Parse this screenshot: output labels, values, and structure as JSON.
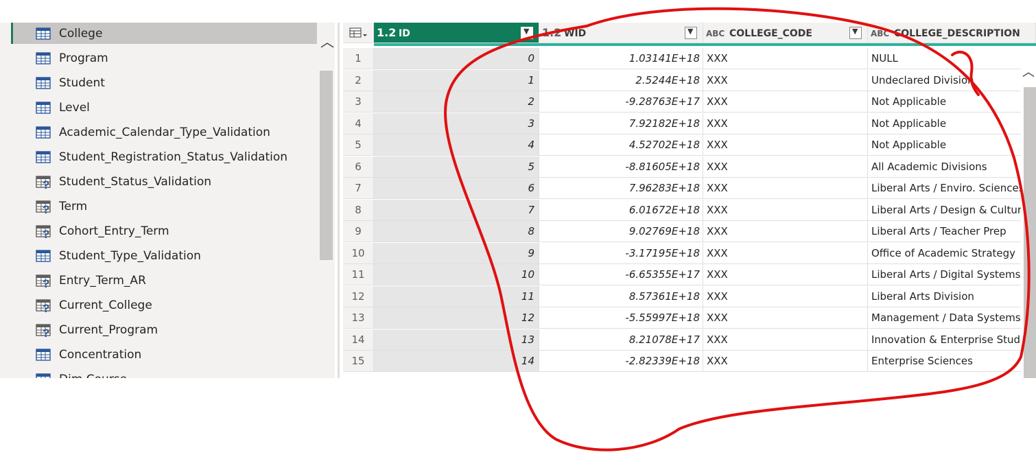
{
  "queries": {
    "items": [
      {
        "label": "College",
        "icon": "table-icon",
        "selected": true
      },
      {
        "label": "Program",
        "icon": "table-icon"
      },
      {
        "label": "Student",
        "icon": "table-icon"
      },
      {
        "label": "Level",
        "icon": "table-icon"
      },
      {
        "label": "Academic_Calendar_Type_Validation",
        "icon": "table-icon"
      },
      {
        "label": "Student_Registration_Status_Validation",
        "icon": "table-icon"
      },
      {
        "label": "Student_Status_Validation",
        "icon": "table-question-icon"
      },
      {
        "label": "Term",
        "icon": "table-question-icon"
      },
      {
        "label": "Cohort_Entry_Term",
        "icon": "table-question-icon"
      },
      {
        "label": "Student_Type_Validation",
        "icon": "table-icon"
      },
      {
        "label": "Entry_Term_AR",
        "icon": "table-question-icon"
      },
      {
        "label": "Current_College",
        "icon": "table-question-icon"
      },
      {
        "label": "Current_Program",
        "icon": "table-question-icon"
      },
      {
        "label": "Concentration",
        "icon": "table-icon"
      },
      {
        "label": "Dim Course",
        "icon": "table-icon"
      }
    ]
  },
  "grid": {
    "columns": [
      {
        "type": "1.2",
        "name": "ID"
      },
      {
        "type": "1.2",
        "name": "WID"
      },
      {
        "type": "ABC",
        "name": "COLLEGE_CODE"
      },
      {
        "type": "ABC",
        "name": "COLLEGE_DESCRIPTION"
      }
    ],
    "rows": [
      {
        "n": "1",
        "id": "0",
        "wid": "1.03141E+18",
        "code": "XXX",
        "desc": "NULL"
      },
      {
        "n": "2",
        "id": "1",
        "wid": "2.5244E+18",
        "code": "XXX",
        "desc": "Undeclared Division"
      },
      {
        "n": "3",
        "id": "2",
        "wid": "-9.28763E+17",
        "code": "XXX",
        "desc": "Not Applicable"
      },
      {
        "n": "4",
        "id": "3",
        "wid": "7.92182E+18",
        "code": "XXX",
        "desc": "Not Applicable"
      },
      {
        "n": "5",
        "id": "4",
        "wid": "4.52702E+18",
        "code": "XXX",
        "desc": "Not Applicable"
      },
      {
        "n": "6",
        "id": "5",
        "wid": "-8.81605E+18",
        "code": "XXX",
        "desc": "All Academic Divisions"
      },
      {
        "n": "7",
        "id": "6",
        "wid": "7.96283E+18",
        "code": "XXX",
        "desc": "Liberal Arts / Enviro. Sciences"
      },
      {
        "n": "8",
        "id": "7",
        "wid": "6.01672E+18",
        "code": "XXX",
        "desc": "Liberal Arts / Design & Culture"
      },
      {
        "n": "9",
        "id": "8",
        "wid": "9.02769E+18",
        "code": "XXX",
        "desc": "Liberal Arts / Teacher Prep"
      },
      {
        "n": "10",
        "id": "9",
        "wid": "-3.17195E+18",
        "code": "XXX",
        "desc": "Office of Academic Strategy"
      },
      {
        "n": "11",
        "id": "10",
        "wid": "-6.65355E+17",
        "code": "XXX",
        "desc": "Liberal Arts / Digital Systems"
      },
      {
        "n": "12",
        "id": "11",
        "wid": "8.57361E+18",
        "code": "XXX",
        "desc": "Liberal Arts Division"
      },
      {
        "n": "13",
        "id": "12",
        "wid": "-5.55997E+18",
        "code": "XXX",
        "desc": "Management / Data Systems"
      },
      {
        "n": "14",
        "id": "13",
        "wid": "8.21078E+17",
        "code": "XXX",
        "desc": "Innovation & Enterprise Studies"
      },
      {
        "n": "15",
        "id": "14",
        "wid": "-2.82339E+18",
        "code": "XXX",
        "desc": "Enterprise Sciences"
      }
    ]
  },
  "colors": {
    "selected_column": "#107c5a",
    "header_bar": "#2bb3a0",
    "annotation": "#e01010"
  }
}
